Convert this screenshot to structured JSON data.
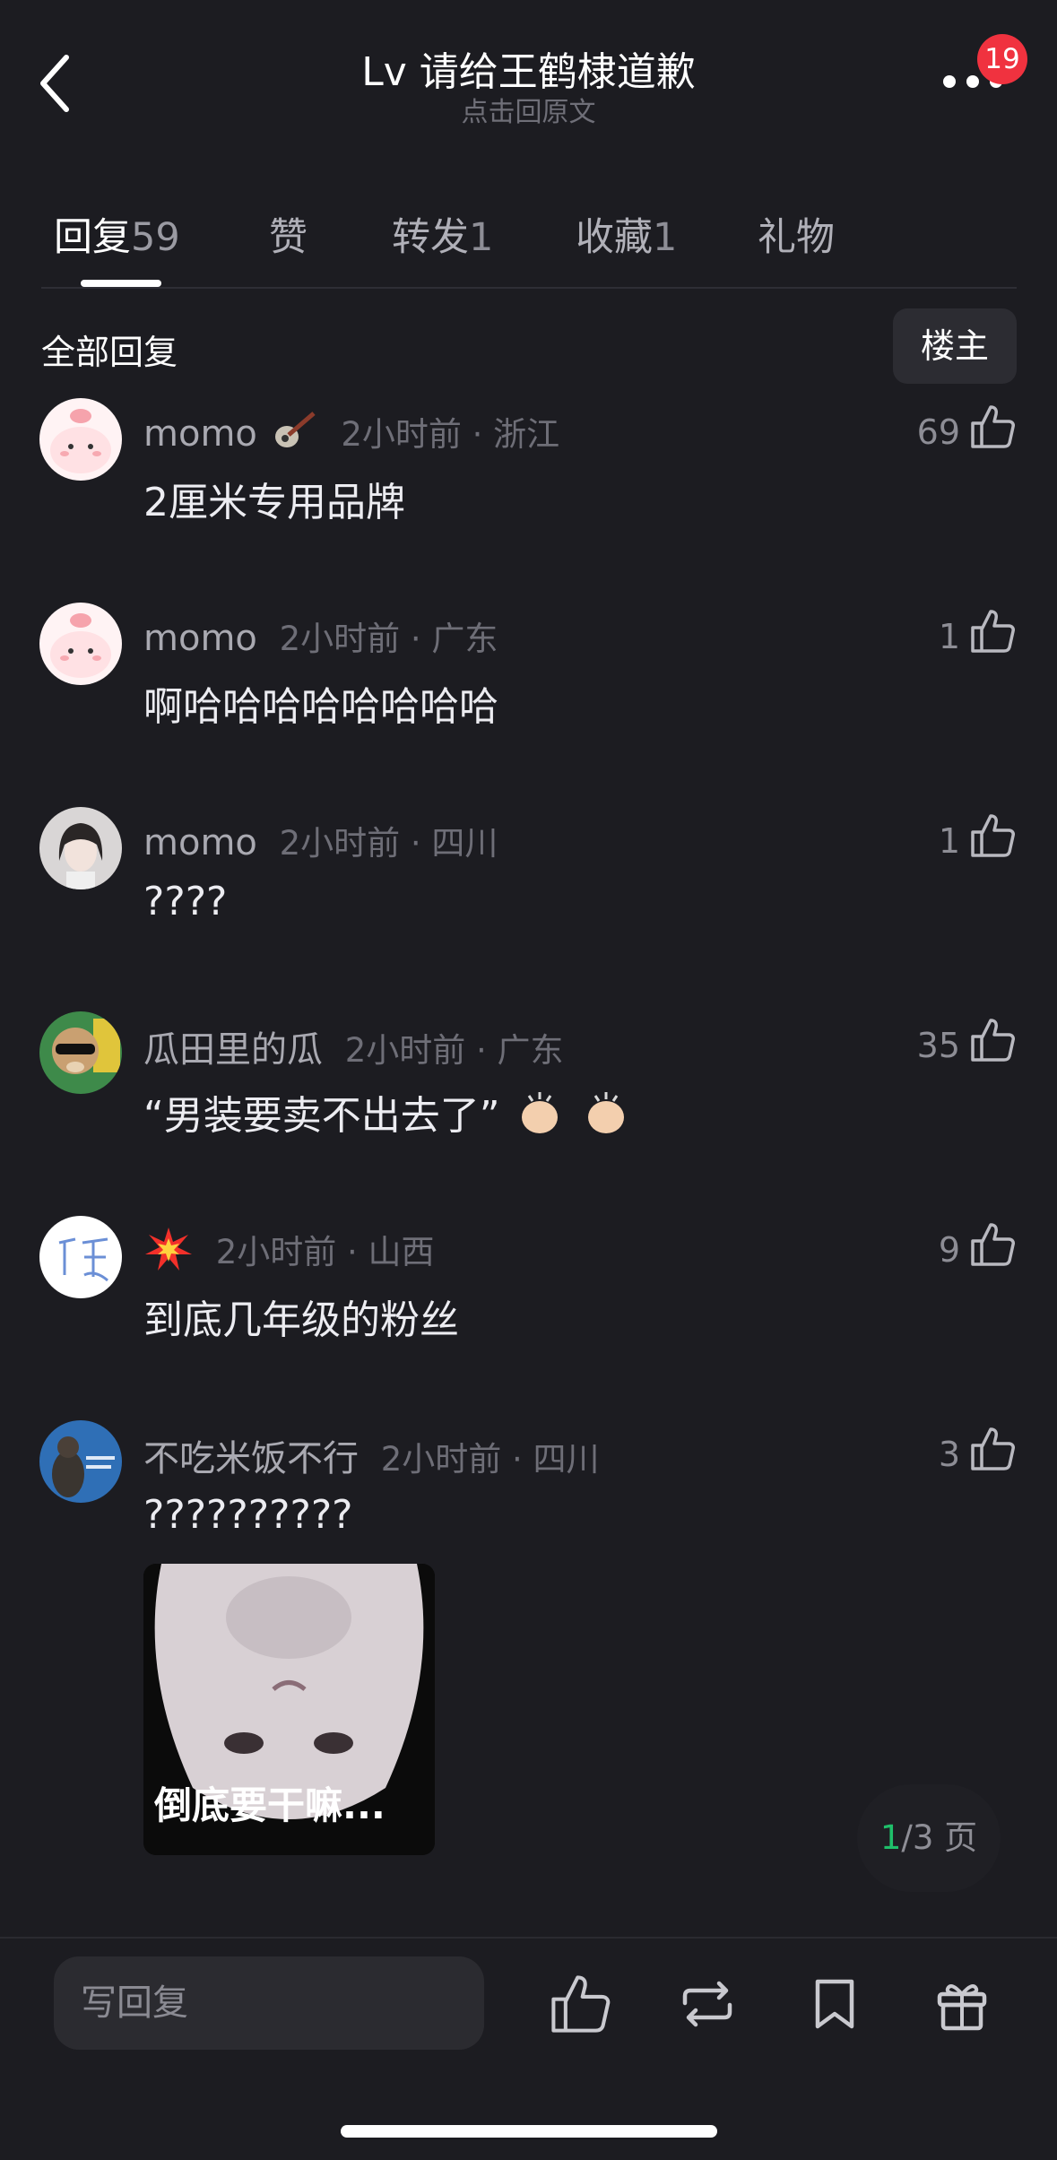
{
  "header": {
    "title": "Lv 请给王鹤棣道歉",
    "subtitle": "点击回原文",
    "notification_count": "19"
  },
  "tabs": [
    {
      "label": "回复",
      "count": "59",
      "active": true
    },
    {
      "label": "赞",
      "count": ""
    },
    {
      "label": "转发",
      "count": "1"
    },
    {
      "label": "收藏",
      "count": "1"
    },
    {
      "label": "礼物",
      "count": ""
    }
  ],
  "filter": {
    "label": "全部回复",
    "owner_button": "楼主"
  },
  "comments": [
    {
      "user": "momo",
      "time": "2小时前 · 浙江",
      "likes": "69",
      "text": "2厘米专用品牌"
    },
    {
      "user": "momo",
      "time": "2小时前 · 广东",
      "likes": "1",
      "text": "啊哈哈哈哈哈哈哈哈"
    },
    {
      "user": "momo",
      "time": "2小时前 · 四川",
      "likes": "1",
      "text": "????"
    },
    {
      "user": "瓜田里的瓜",
      "time": "2小时前 · 广东",
      "likes": "35",
      "text": "“男装要卖不出去了”"
    },
    {
      "user": "",
      "time": "2小时前 · 山西",
      "likes": "9",
      "text": "到底几年级的粉丝"
    },
    {
      "user": "不吃米饭不行",
      "time": "2小时前 · 四川",
      "likes": "3",
      "text": "??????????",
      "image_caption": "倒底要干嘛..."
    }
  ],
  "pager": {
    "current": "1",
    "total_text": "/3 页"
  },
  "bottom_bar": {
    "reply_placeholder": "写回复"
  },
  "colors": {
    "background": "#1c1c21",
    "badge": "#f0323f",
    "pager_current": "#1fbf6a"
  }
}
